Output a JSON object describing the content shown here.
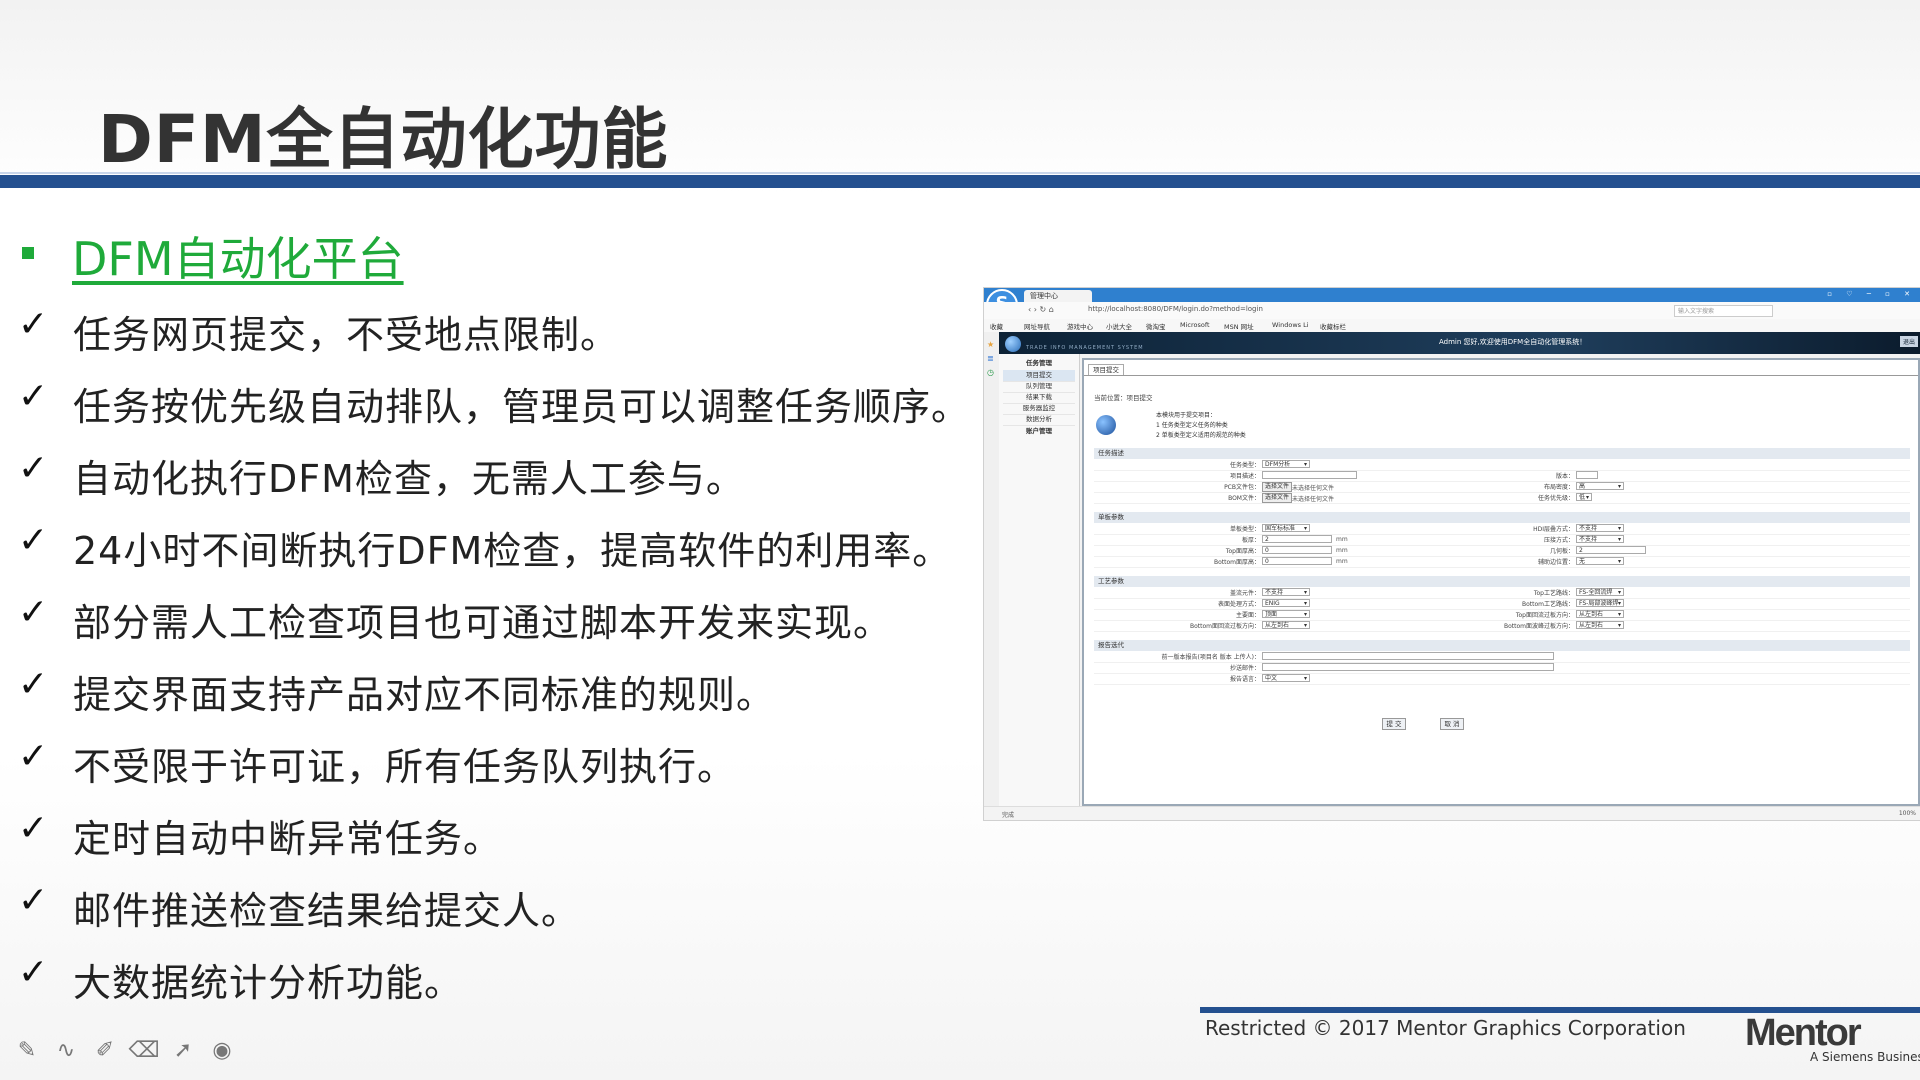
{
  "slide": {
    "title": "DFM全自动化功能",
    "subheading": "DFM自动化平台",
    "bullets": [
      "任务网页提交，不受地点限制。",
      "任务按优先级自动排队，管理员可以调整任务顺序。",
      "自动化执行DFM检查，无需人工参与。",
      "24小时不间断执行DFM检查，提高软件的利用率。",
      "部分需人工检查项目也可通过脚本开发来实现。",
      "提交界面支持产品对应不同标准的规则。",
      "不受限于许可证，所有任务队列执行。",
      "定时自动中断异常任务。",
      "邮件推送检查结果给提交人。",
      "大数据统计分析功能。"
    ],
    "checkmark": "✓",
    "footer": "Restricted © 2017 Mentor Graphics Corporation",
    "logo": "Mentor",
    "logo_sub": "A Siemens Business",
    "tools": [
      "pen-icon",
      "curve-icon",
      "highlighter-icon",
      "eraser-icon",
      "pointer-icon",
      "record-icon"
    ],
    "colors": {
      "title_bar": "#24508f",
      "accent_green": "#1faa3a"
    }
  },
  "browser": {
    "tab_title": "管理中心",
    "window_controls": "▫ ♡ ─ ▫ ✕",
    "url": "http://localhost:8080/DFM/login.do?method=login",
    "search_placeholder": "输入文字搜索",
    "favorites": [
      "收藏",
      "网址导航",
      "游戏中心",
      "小说大全",
      "微淘宝",
      "Microsoft",
      "MSN 网址",
      "Windows Li",
      "收藏标栏"
    ],
    "banner_system": "TRADE INFO MANAGEMENT SYSTEM",
    "banner_welcome": "Admin 您好,欢迎使用DFM全自动化管理系统！",
    "banner_quit": "退出",
    "nav": {
      "task_mgmt": "任务管理",
      "items": [
        "项目提交",
        "队列管理",
        "结果下载",
        "服务器监控",
        "数据分析"
      ],
      "account": "账户管理"
    },
    "content_tab": "项目提交",
    "breadcrumb": "当前位置：项目提交",
    "notes": [
      "本模块用于提交项目：",
      "1 任务类型定义任务的种类",
      "2 单板类型定义适用的规范的种类"
    ],
    "sections": {
      "task": "任务描述",
      "board": "单板参数",
      "process": "工艺参数",
      "report": "报告选代"
    },
    "task": {
      "type_label": "任务类型：",
      "type_value": "DFM分析",
      "desc_label": "项目描述：",
      "version_label": "版本：",
      "pcb_label": "PCB文件包：",
      "file_btn": "选择文件",
      "no_file": "未选择任何文件",
      "layout_label": "布局密度：",
      "layout_value": "高",
      "bom_label": "BOM文件：",
      "priority_label": "任务优先级：",
      "priority_value": "低"
    },
    "board": {
      "type_label": "单板类型：",
      "type_value": "国军标标准",
      "thickness_label": "板厚：",
      "thickness_value": "2",
      "top_label": "Top面厚高：",
      "top_value": "0",
      "bottom_label": "Bottom面厚高：",
      "bottom_value": "0",
      "unit": "mm",
      "hdi_label": "HDI层叠方式：",
      "hdi_value": "不支持",
      "pressfit_label": "压接方式：",
      "pressfit_value": "不支持",
      "thk_label": "几何板：",
      "thk_value": "2",
      "aux_label": "辅助边位置：",
      "aux_value": "无"
    },
    "process": {
      "reinforce_label": "盖流元件：",
      "reinforce_value": "不支持",
      "surface_label": "表面处理方式：",
      "surface_value": "ENIG",
      "main_label": "主要面：",
      "main_value": "顶面",
      "bottom_dir_label": "Bottom面回流过板方向：",
      "bottom_dir_value": "从左到右",
      "top_proc_label": "Top工艺路线：",
      "top_proc_value": "FS-全回流焊",
      "bottom_proc_label": "Bottom工艺路线：",
      "bottom_proc_value": "FS-局部波峰焊",
      "top_dir_label": "Top面回流过板方向：",
      "top_dir_value": "从左到右",
      "bottom_wave_label": "Bottom面波峰过板方向：",
      "bottom_wave_value": "从左到右"
    },
    "report": {
      "prev_label": "前一版本报告(项目名 版本 上传人)：",
      "cc_label": "抄送邮件：",
      "lang_label": "报告语言：",
      "lang_value": "中文"
    },
    "submit": "提 交",
    "cancel": "取 消",
    "status": "完成",
    "zoom": "100%"
  }
}
